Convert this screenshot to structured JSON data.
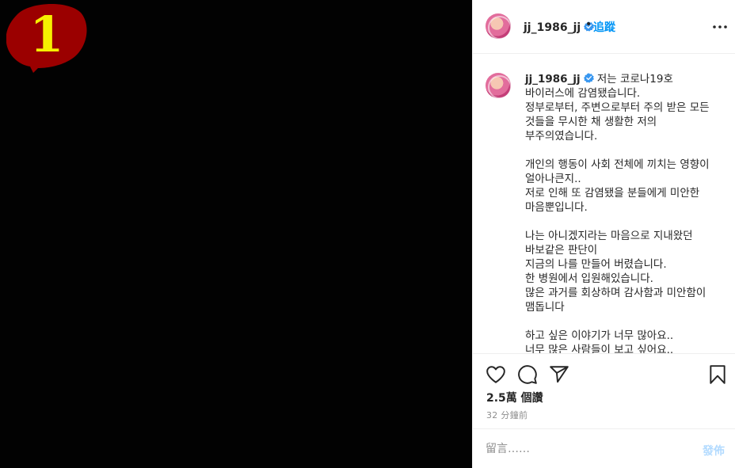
{
  "media": {
    "badge_number": "1",
    "badge_color": "#9b0000",
    "badge_text_color": "#f6f000"
  },
  "post": {
    "username": "jj_1986_jj",
    "verified": true,
    "separator": "•",
    "follow_label": "追蹤",
    "more_icon": "more-horizontal-icon"
  },
  "caption": {
    "username": "jj_1986_jj",
    "text": "저는 코로나19호 바이러스에 감염됐습니다.\n정부로부터, 주변으로부터 주의 받은 모든 것들을 무시한 채 생활한 저의 부주의였습니다.\n\n개인의 행동이 사회 전체에 끼치는 영향이 얼아나큰지..\n저로 인해 또 감염됐을 분들에게 미안한 마음뿐입니다.\n\n나는 아니겠지라는 마음으로 지내왔던 바보같은 판단이\n지금의 나를 만들어 버렸습니다.\n한 병원에서 입원해있습니다.\n많은 과거를 회상하며 감사함과 미안함이 맴돕니다\n\n하고 싶은 이야기가 너무 많아요..\n너무 많은 사람들이 보고 싶어요.."
  },
  "actions": {
    "like_icon": "heart-icon",
    "comment_icon": "comment-icon",
    "share_icon": "share-icon",
    "save_icon": "bookmark-icon",
    "likes": "2.5萬 個讚",
    "time": "32 分鐘前"
  },
  "comment": {
    "placeholder": "留言……",
    "post_label": "發佈"
  },
  "colors": {
    "accent": "#0095f6",
    "verified": "#3897f0",
    "post_disabled": "#b3dbff"
  }
}
